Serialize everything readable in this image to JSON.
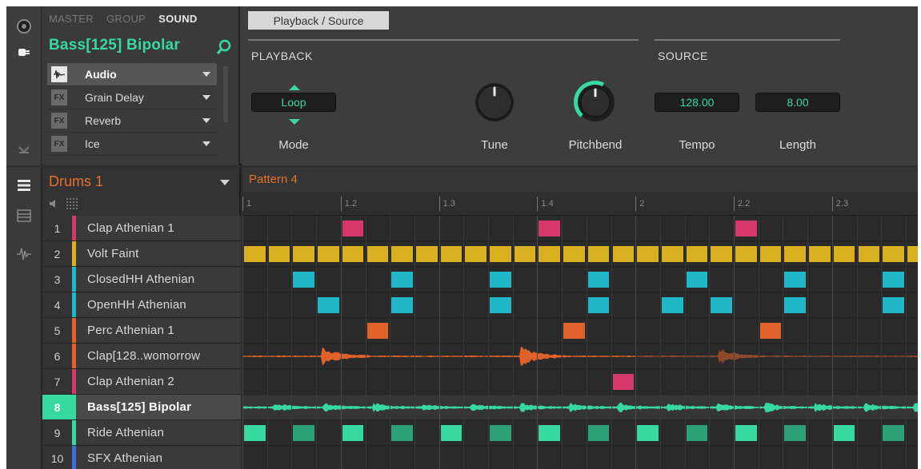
{
  "colors": {
    "accent": "#37d9a0",
    "orange": "#e8702a",
    "pink": "#d6386b",
    "yellow": "#d9b020",
    "cyan": "#20b8c8",
    "perc": "#e0622a",
    "green_dim": "#2ea078",
    "blue": "#3a6fd6"
  },
  "sound_panel": {
    "tabs": [
      "MASTER",
      "GROUP",
      "SOUND"
    ],
    "active_tab": "SOUND",
    "sound_name": "Bass[125] Bipolar",
    "slots": [
      {
        "badge_icon": "waveform-icon",
        "label": "Audio",
        "active": true
      },
      {
        "badge": "FX",
        "label": "Grain Delay"
      },
      {
        "badge": "FX",
        "label": "Reverb"
      },
      {
        "badge": "FX",
        "label": "Ice"
      }
    ]
  },
  "params": {
    "page_tab": "Playback / Source",
    "sections": {
      "playback": "PLAYBACK",
      "source": "SOURCE"
    },
    "mode": {
      "value": "Loop",
      "label": "Mode"
    },
    "tune": {
      "label": "Tune"
    },
    "pitchbend": {
      "label": "Pitchbend"
    },
    "tempo": {
      "value": "128.00",
      "label": "Tempo"
    },
    "length": {
      "value": "8.00",
      "label": "Length"
    }
  },
  "group": {
    "name": "Drums 1",
    "sounds": [
      {
        "num": "1",
        "name": "Clap Athenian 1",
        "color": "#d6386b"
      },
      {
        "num": "2",
        "name": "Volt Faint",
        "color": "#d9b020"
      },
      {
        "num": "3",
        "name": "ClosedHH Athenian",
        "color": "#20b8c8"
      },
      {
        "num": "4",
        "name": "OpenHH Athenian",
        "color": "#20b8c8"
      },
      {
        "num": "5",
        "name": "Perc Athenian 1",
        "color": "#e0622a"
      },
      {
        "num": "6",
        "name": "Clap[128..womorrow",
        "color": "#e0622a"
      },
      {
        "num": "7",
        "name": "Clap Athenian 2",
        "color": "#d6386b"
      },
      {
        "num": "8",
        "name": "Bass[125] Bipolar",
        "color": "#37d9a0",
        "active": true
      },
      {
        "num": "9",
        "name": "Ride Athenian",
        "color": "#37d9a0"
      },
      {
        "num": "10",
        "name": "SFX Athenian",
        "color": "#3a6fd6"
      }
    ]
  },
  "pattern": {
    "name": "Pattern 4",
    "ruler": [
      "1",
      "1.2",
      "1.3",
      "1.4",
      "2",
      "2.2",
      "2.3"
    ],
    "steps_visible": 27.5,
    "notes": {
      "row1": [
        4,
        12,
        20
      ],
      "row2": [
        0,
        1,
        2,
        3,
        4,
        5,
        6,
        7,
        8,
        9,
        10,
        11,
        12,
        13,
        14,
        15,
        16,
        17,
        18,
        19,
        20,
        21,
        22,
        23,
        24,
        25,
        26,
        27
      ],
      "row3": [
        2,
        6,
        10,
        14,
        18,
        22,
        26
      ],
      "row4": [
        3,
        6,
        10,
        14,
        17,
        19,
        22,
        26
      ],
      "row5": [
        5,
        13,
        21
      ],
      "row7": [
        15
      ],
      "row9": [
        0,
        2,
        4,
        6,
        8,
        10,
        12,
        14,
        16,
        18,
        20,
        22,
        24,
        26
      ]
    }
  }
}
